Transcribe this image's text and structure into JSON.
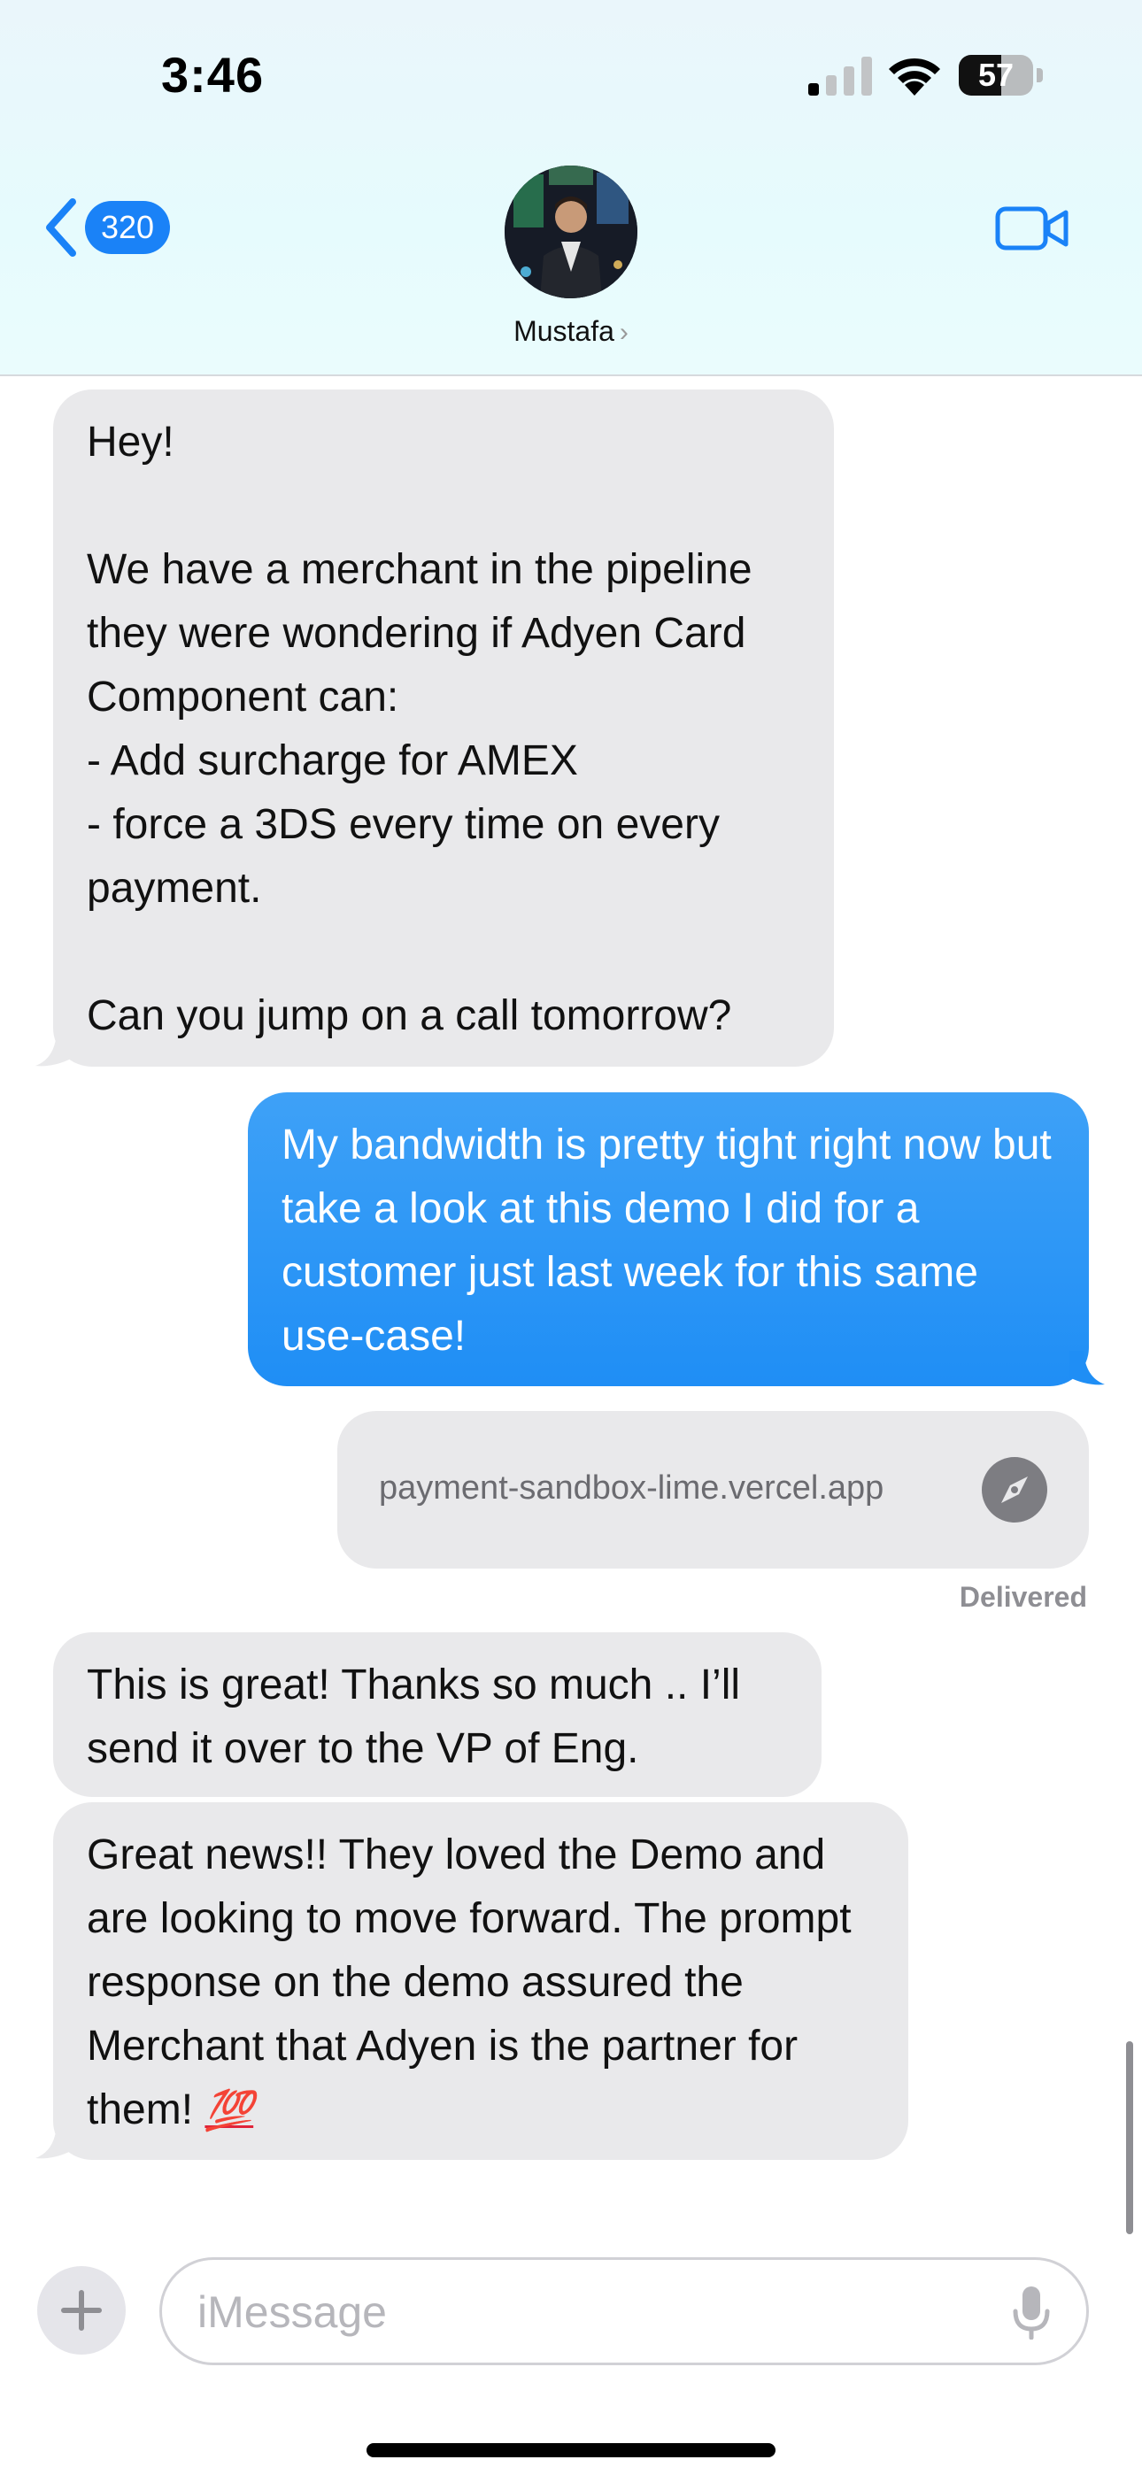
{
  "status_bar": {
    "time": "3:46",
    "battery_level": "57",
    "battery_fraction": 0.57,
    "icons": [
      "cellular-signal-icon",
      "wifi-icon",
      "battery-icon"
    ]
  },
  "nav": {
    "back_badge": "320",
    "contact_name": "Mustafa",
    "contact_chevron": "›",
    "icons": [
      "chevron-left-icon",
      "video-camera-icon"
    ]
  },
  "messages": [
    {
      "direction": "incoming",
      "text": "Hey!\n\nWe have a merchant in the pipeline they were wondering if Adyen Card Component can:\n- Add surcharge for AMEX\n- force a 3DS every time on every payment.\n\nCan you jump on a call tomorrow?"
    },
    {
      "direction": "outgoing",
      "text": "My bandwidth is pretty tight right now but take a look at this demo I did for a customer just last week for this same use-case!"
    },
    {
      "direction": "outgoing",
      "type": "link",
      "text": "payment-sandbox-lime.vercel.app",
      "icon": "compass-icon"
    },
    {
      "direction": "incoming",
      "text": "This is great! Thanks so much .. I’ll send it over to the VP of Eng."
    },
    {
      "direction": "incoming",
      "text": "Great news!! They loved the Demo and are looking to move forward. The prompt response on the demo assured the Merchant that Adyen is the partner for them! ",
      "emoji": "💯"
    }
  ],
  "delivery_status": "Delivered",
  "compose": {
    "placeholder": "iMessage",
    "icons": [
      "plus-icon",
      "microphone-icon"
    ]
  },
  "colors": {
    "accent": "#1a82f7",
    "outgoing_bubble": "#2a96f6",
    "incoming_bubble": "#e9e9eb",
    "header_bg": "#e8f9fc"
  }
}
